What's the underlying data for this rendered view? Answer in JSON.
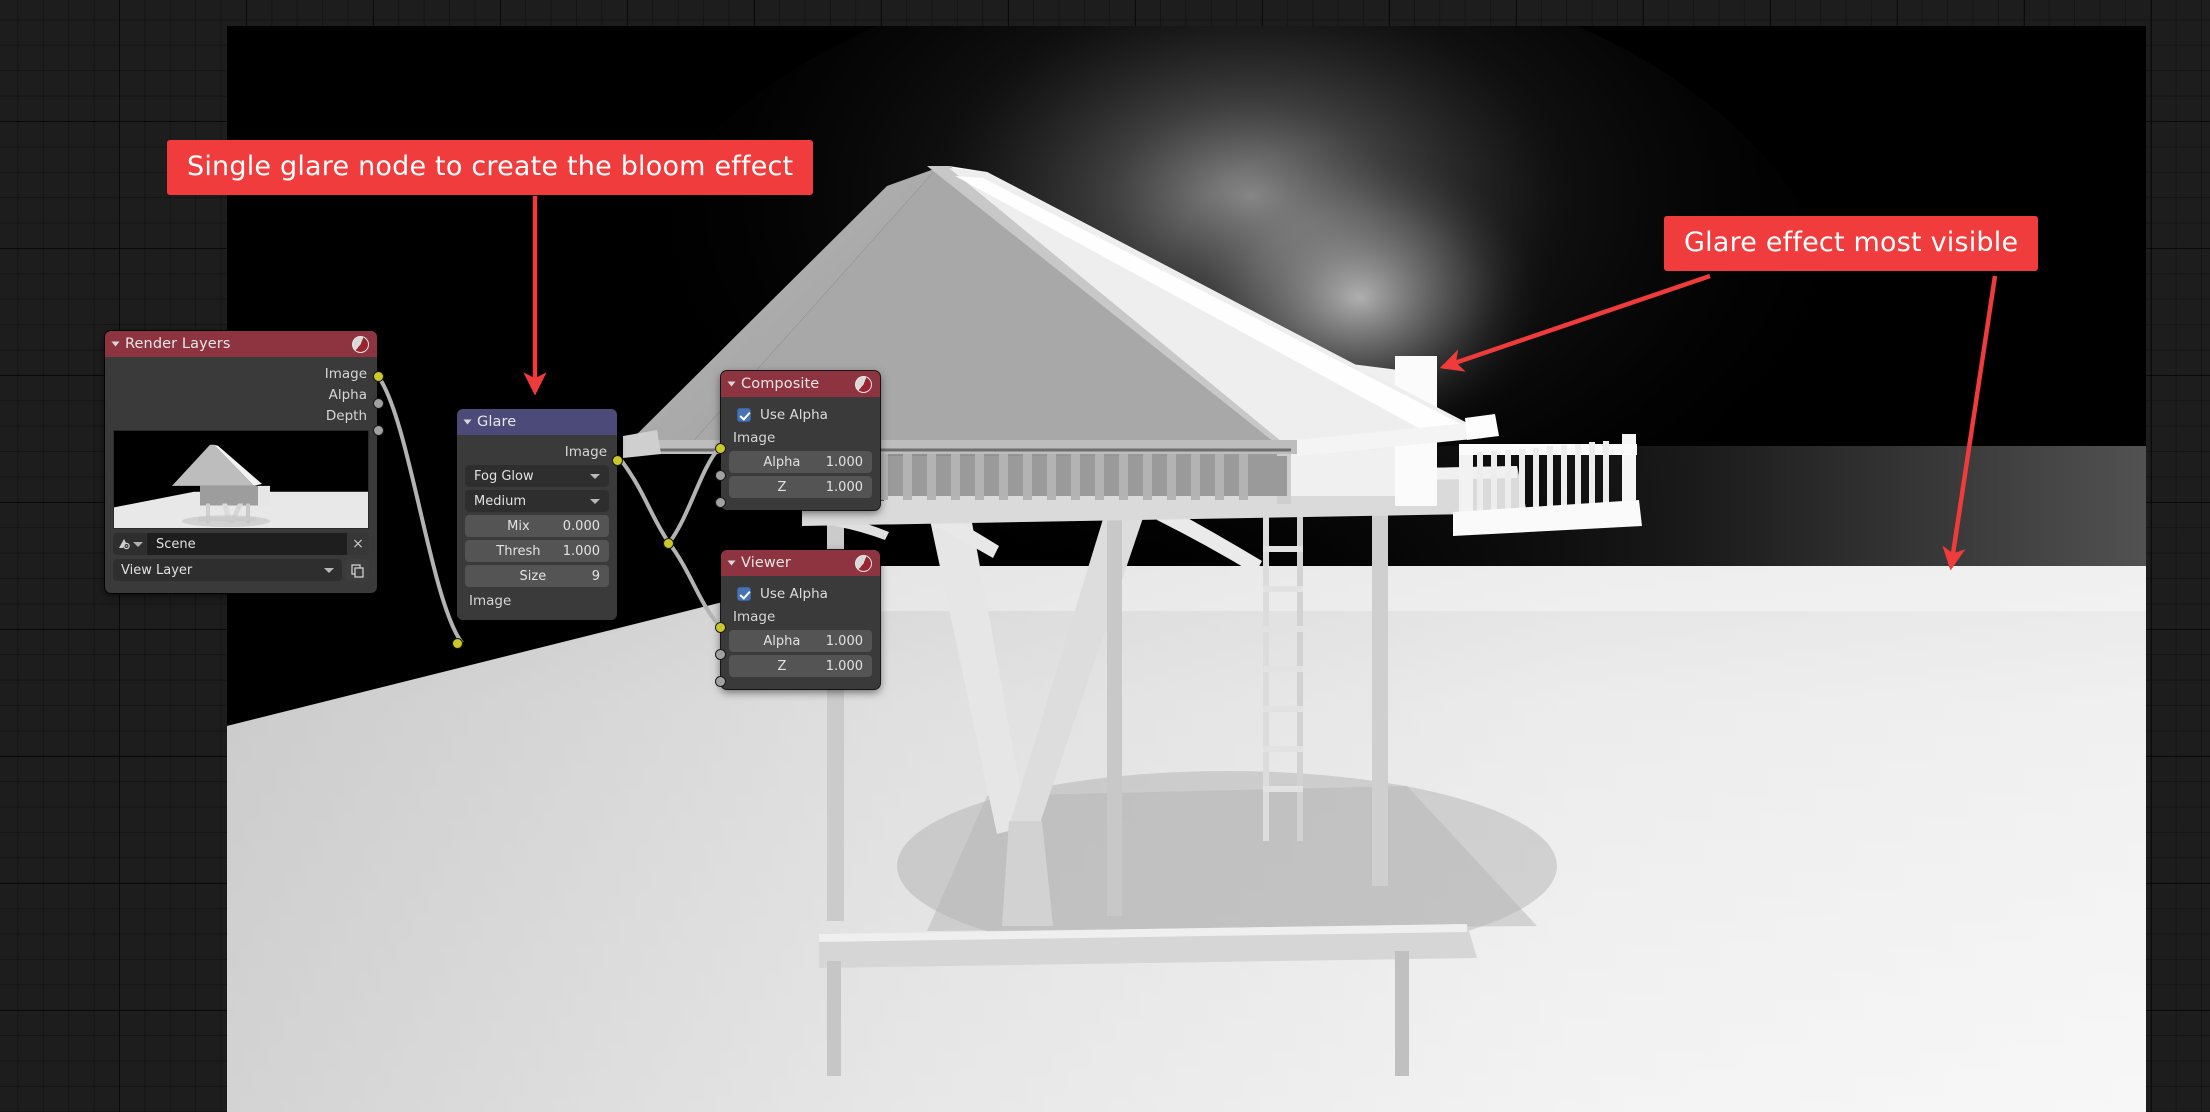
{
  "app": {
    "editor": "blender-compositor",
    "background_color": "#1d1d1d",
    "accent_red": "#f03c3c",
    "node_header_output_color": "#8e3440",
    "node_header_filter_color": "#4b4a78",
    "socket_image_color": "#ccc82a",
    "socket_value_color": "#a1a1a1"
  },
  "annotations": [
    {
      "id": "anno-glare-node",
      "text": "Single glare node to create the bloom effect"
    },
    {
      "id": "anno-glare-visible",
      "text": "Glare effect most visible"
    }
  ],
  "nodes": {
    "render_layers": {
      "title": "Render Layers",
      "header_icon": "scene-sphere-icon",
      "outputs": [
        {
          "label": "Image",
          "socket": "image"
        },
        {
          "label": "Alpha",
          "socket": "value"
        },
        {
          "label": "Depth",
          "socket": "value"
        }
      ],
      "preview": "render-preview-thumbnail",
      "scene_field": {
        "icon": "scene-icon",
        "value": "Scene",
        "clear_label": "×"
      },
      "view_layer_field": {
        "value": "View Layer",
        "copy_icon": "new-viewlayer-icon"
      }
    },
    "glare": {
      "title": "Glare",
      "outputs": [
        {
          "label": "Image",
          "socket": "image"
        }
      ],
      "glare_type": "Fog Glow",
      "quality": "Medium",
      "properties": [
        {
          "name": "Mix",
          "value": "0.000"
        },
        {
          "name": "Thresh",
          "value": "1.000"
        },
        {
          "name": "Size",
          "value": "9"
        }
      ],
      "inputs": [
        {
          "label": "Image",
          "socket": "image"
        }
      ]
    },
    "composite": {
      "title": "Composite",
      "header_icon": "scene-sphere-icon",
      "use_alpha": {
        "label": "Use Alpha",
        "checked": true
      },
      "inputs": [
        {
          "label": "Image",
          "socket": "image",
          "value": null
        },
        {
          "label": "Alpha",
          "socket": "value",
          "value": "1.000"
        },
        {
          "label": "Z",
          "socket": "value",
          "value": "1.000"
        }
      ]
    },
    "viewer": {
      "title": "Viewer",
      "header_icon": "scene-sphere-icon",
      "use_alpha": {
        "label": "Use Alpha",
        "checked": true
      },
      "inputs": [
        {
          "label": "Image",
          "socket": "image",
          "value": null
        },
        {
          "label": "Alpha",
          "socket": "value",
          "value": "1.000"
        },
        {
          "label": "Z",
          "socket": "value",
          "value": "1.000"
        }
      ]
    }
  },
  "render_backdrop": {
    "description": "grayscale clay render of a stilted treehouse hut with an A-frame roof, balcony railing, ladder and plank bench on a bright floor plane against a black background with a bloom glare halo"
  }
}
